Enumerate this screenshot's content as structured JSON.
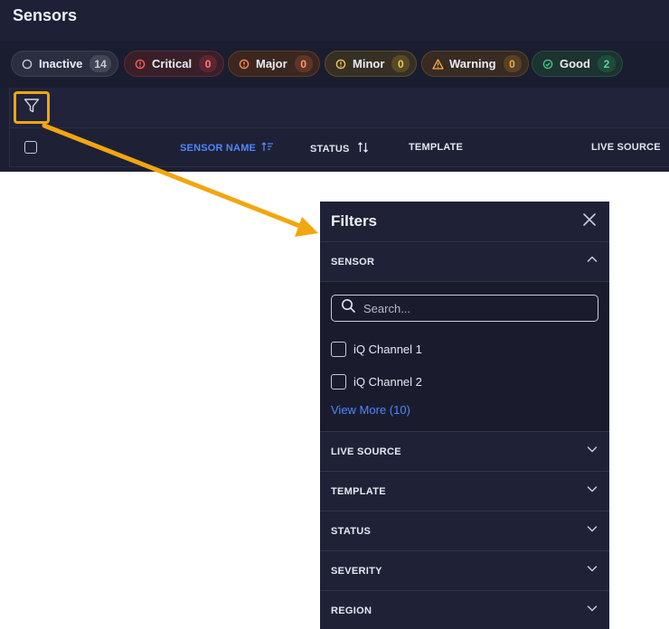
{
  "app": {
    "title": "Sensors",
    "status_chips": [
      {
        "label": "Inactive",
        "count": "14",
        "icon": "circle-outline-icon"
      },
      {
        "label": "Critical",
        "count": "0",
        "icon": "alert-circle-icon"
      },
      {
        "label": "Major",
        "count": "0",
        "icon": "alert-circle-icon"
      },
      {
        "label": "Minor",
        "count": "0",
        "icon": "alert-circle-icon"
      },
      {
        "label": "Warning",
        "count": "0",
        "icon": "warning-triangle-icon"
      },
      {
        "label": "Good",
        "count": "2",
        "icon": "check-circle-icon"
      }
    ],
    "table_columns": [
      {
        "label": "SENSOR NAME",
        "sort": "active-sort-icon"
      },
      {
        "label": "STATUS",
        "sort": "sort-arrows-icon"
      },
      {
        "label": "TEMPLATE"
      },
      {
        "label": "LIVE SOURCE"
      }
    ]
  },
  "filters": {
    "title": "Filters",
    "sensor_section": {
      "label": "SENSOR",
      "search_placeholder": "Search...",
      "options": [
        "iQ Channel 1",
        "iQ Channel 2"
      ],
      "view_more": "View More (10)"
    },
    "sections": [
      "LIVE SOURCE",
      "TEMPLATE",
      "STATUS",
      "SEVERITY",
      "REGION"
    ]
  },
  "colors": {
    "accent": "#4f86ff",
    "highlight": "#f2a60f",
    "critical": "#ff5f5f",
    "major": "#ff8a4a",
    "minor": "#f3c55b",
    "warning": "#f5a94a",
    "good": "#3fc48a"
  }
}
